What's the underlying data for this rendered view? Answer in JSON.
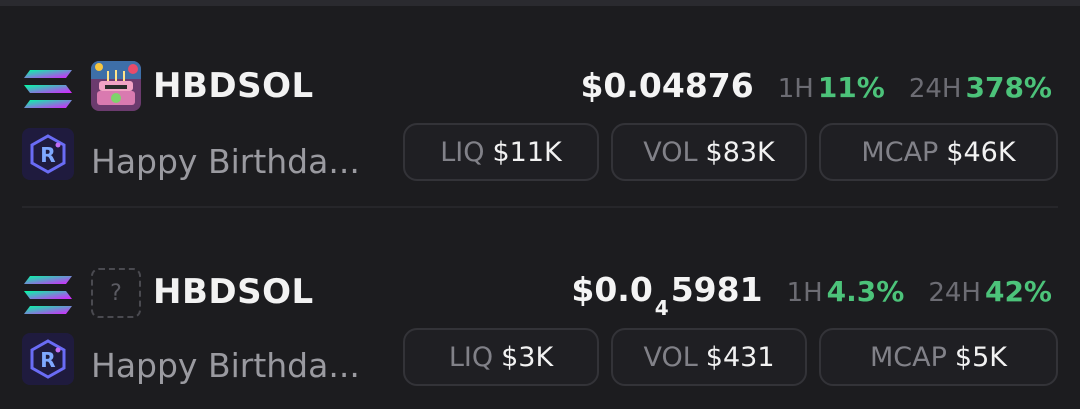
{
  "tokens": [
    {
      "symbol": "HBDSOL",
      "name": "Happy Birthda...",
      "price_main": "$0.04876",
      "price_prefix": "",
      "price_sub": "",
      "price_tail": "",
      "h1_label": "1H",
      "h1_value": "11%",
      "h24_label": "24H",
      "h24_value": "378%",
      "liq_label": "LIQ",
      "liq_value": "$11K",
      "vol_label": "VOL",
      "vol_value": "$83K",
      "mcap_label": "MCAP",
      "mcap_value": "$46K",
      "image": "birthday-cake-image"
    },
    {
      "symbol": "HBDSOL",
      "name": "Happy Birthda...",
      "price_main": "",
      "price_prefix": "$0.0",
      "price_sub": "4",
      "price_tail": "5981",
      "h1_label": "1H",
      "h1_value": "4.3%",
      "h24_label": "24H",
      "h24_value": "42%",
      "liq_label": "LIQ",
      "liq_value": "$3K",
      "vol_label": "VOL",
      "vol_value": "$431",
      "mcap_label": "MCAP",
      "mcap_value": "$5K",
      "image": "placeholder-image",
      "placeholder_glyph": "?"
    }
  ],
  "colors": {
    "background": "#1c1c1f",
    "positive": "#4cc37a",
    "muted": "#6c6c73",
    "pill_border": "#333338"
  },
  "icons": {
    "chain": "solana-icon",
    "dex": "raydium-icon"
  }
}
